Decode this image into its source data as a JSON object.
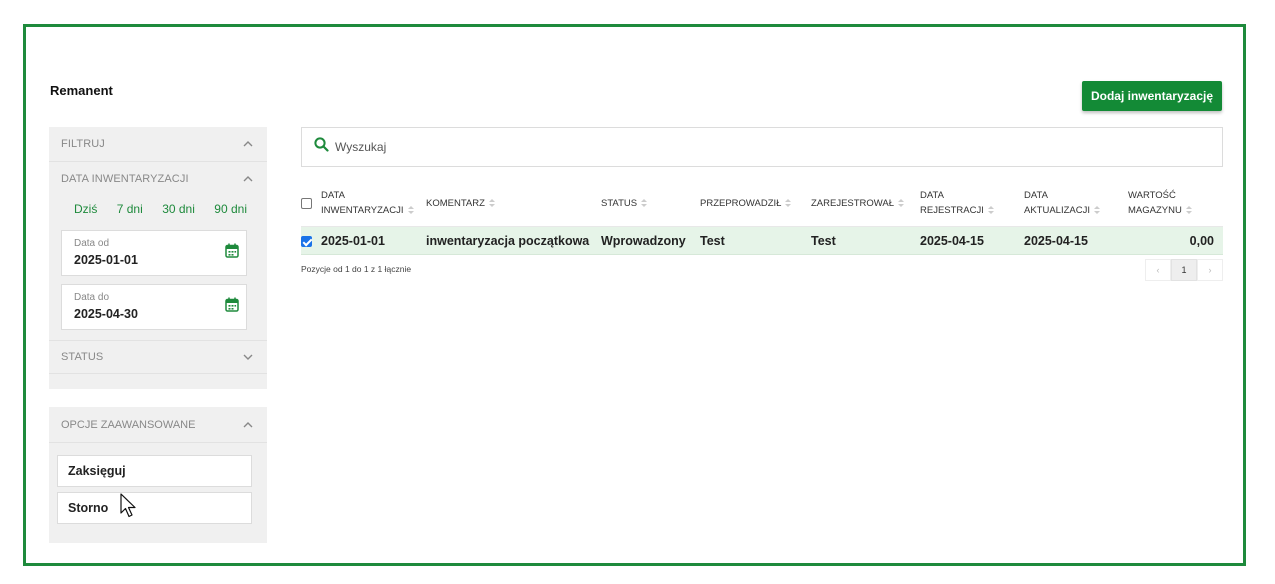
{
  "page": {
    "title": "Remanent",
    "add_button": "Dodaj inwentaryzację",
    "accent_color": "#138a36"
  },
  "filter": {
    "header": "FILTRUJ",
    "date_section": {
      "header": "DATA INWENTARYZACJI",
      "quick_ranges": [
        "Dziś",
        "7 dni",
        "30 dni",
        "90 dni"
      ],
      "date_from": {
        "label": "Data od",
        "value": "2025-01-01"
      },
      "date_to": {
        "label": "Data do",
        "value": "2025-04-30"
      }
    },
    "status_header": "STATUS"
  },
  "advanced": {
    "header": "OPCJE ZAAWANSOWANE",
    "actions": [
      "Zaksięguj",
      "Storno"
    ]
  },
  "search": {
    "placeholder": "Wyszukaj"
  },
  "table": {
    "columns": [
      {
        "line1": "DATA",
        "line2": "INWENTARYZACJI"
      },
      {
        "line1": "",
        "line2": "KOMENTARZ"
      },
      {
        "line1": "",
        "line2": "STATUS"
      },
      {
        "line1": "",
        "line2": "PRZEPROWADZIŁ"
      },
      {
        "line1": "",
        "line2": "ZAREJESTROWAŁ"
      },
      {
        "line1": "DATA",
        "line2": "REJESTRACJI"
      },
      {
        "line1": "DATA",
        "line2": "AKTUALIZACJI"
      },
      {
        "line1": "WARTOŚĆ",
        "line2": "MAGAZYNU"
      }
    ],
    "rows": [
      {
        "selected": true,
        "cells": [
          "2025-01-01",
          "inwentaryzacja początkowa",
          "Wprowadzony",
          "Test",
          "Test",
          "2025-04-15",
          "2025-04-15",
          "0,00"
        ]
      }
    ],
    "summary": "Pozycje od 1 do 1 z 1 łącznie",
    "pagination": {
      "prev": "‹",
      "current": "1",
      "next": "›"
    }
  }
}
